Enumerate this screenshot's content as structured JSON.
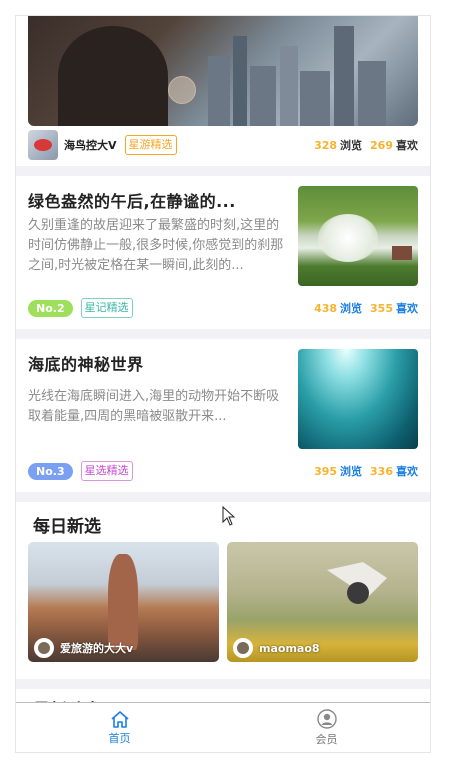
{
  "feed": [
    {
      "author": "海鸟控大V",
      "tag": "星游精选",
      "views": "328",
      "views_label": "浏览",
      "likes": "269",
      "likes_label": "喜欢"
    },
    {
      "title": "绿色盎然的午后,在静谧的...",
      "desc": "久别重逢的故居迎来了最繁盛的时刻,这里的时间仿佛静止一般,很多时候,你感觉到的刹那之间,时光被定格在某一瞬间,此刻的...",
      "badge": "No.2",
      "tag": "星记精选",
      "views": "438",
      "views_label": "浏览",
      "likes": "355",
      "likes_label": "喜欢"
    },
    {
      "title": "海底的神秘世界",
      "desc": "光线在海底瞬间进入,海里的动物开始不断吸取着能量,四周的黑暗被驱散开来...",
      "badge": "No.3",
      "tag": "星选精选",
      "views": "395",
      "views_label": "浏览",
      "likes": "336",
      "likes_label": "喜欢"
    }
  ],
  "daily": {
    "title": "每日新选",
    "items": [
      {
        "user": "爱旅游的大大v"
      },
      {
        "user": "maomao8"
      }
    ]
  },
  "latest": {
    "title": "最新动态"
  },
  "tabbar": {
    "items": [
      {
        "label": "首页",
        "icon": "home-icon",
        "active": true
      },
      {
        "label": "会员",
        "icon": "user-icon",
        "active": false
      }
    ]
  },
  "colors": {
    "accent": "#1a7fe0",
    "count": "#f5b330",
    "badge_no2": "#9ee05c",
    "badge_no3": "#7b9ff3"
  }
}
